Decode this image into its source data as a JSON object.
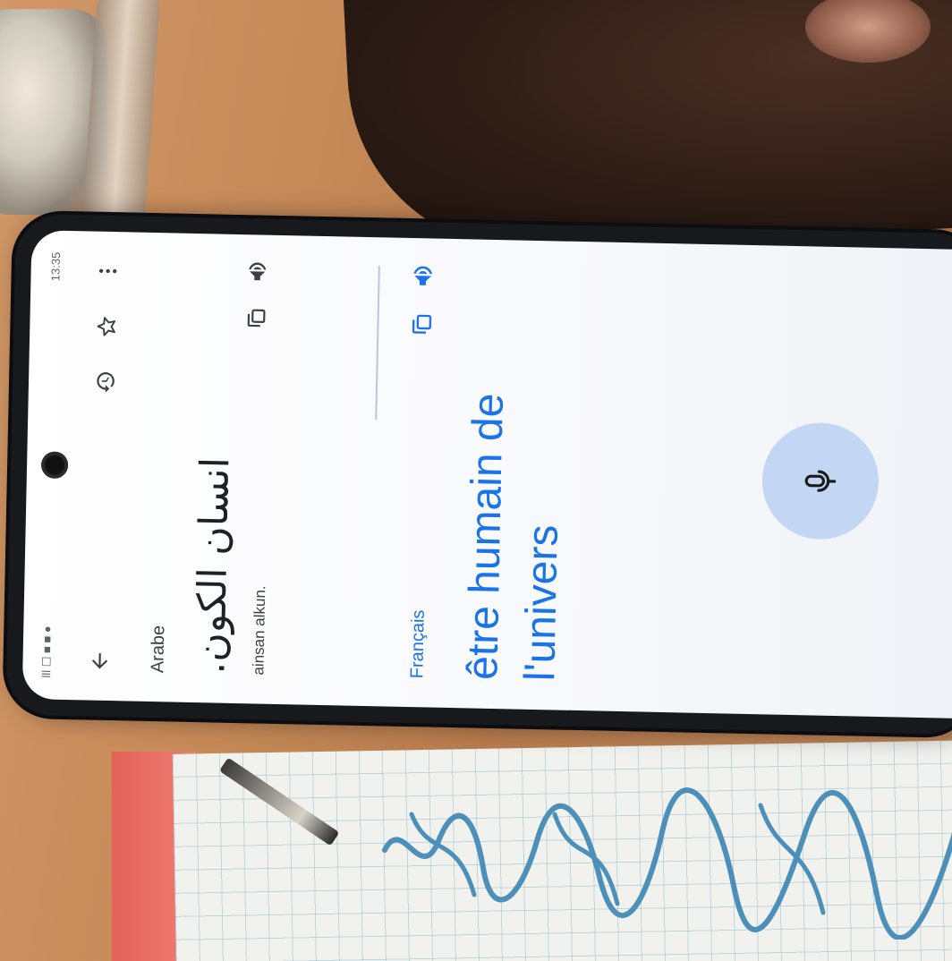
{
  "status_bar": {
    "time": "13:35",
    "indicators": "lll ☐ ■ ■ ●"
  },
  "toolbar": {
    "back_icon": "arrow-left-icon",
    "history_icon": "history-icon",
    "star_icon": "star-icon",
    "more_icon": "more-vert-icon"
  },
  "source": {
    "language": "Arabe",
    "text": "انسان الكون.",
    "transliteration": "ainsan alkun."
  },
  "target": {
    "language": "Français",
    "text": "être humain de l'univers"
  },
  "icons": {
    "copy": "copy-icon",
    "speaker": "speaker-icon",
    "mic": "mic-icon"
  },
  "colors": {
    "accent": "#1a73e8",
    "mic_fab": "#c3d6f3",
    "phone_body": "#17191d"
  }
}
